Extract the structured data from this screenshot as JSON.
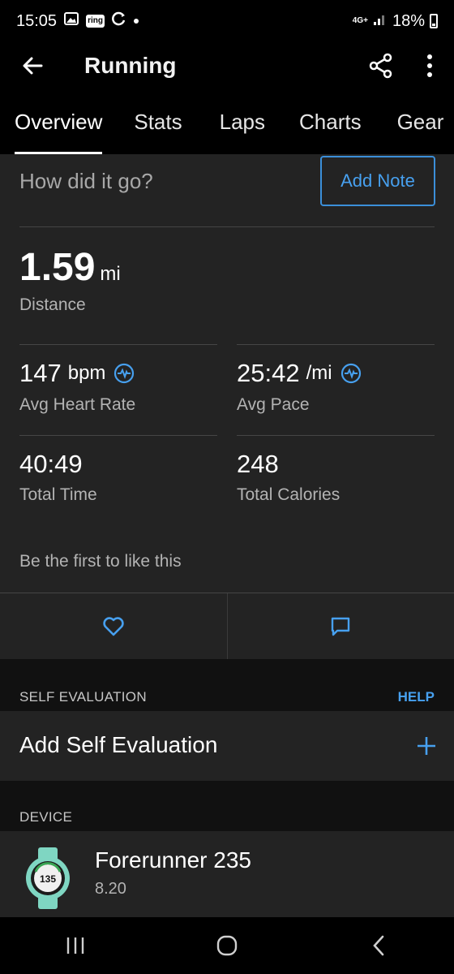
{
  "status_bar": {
    "time": "15:05",
    "network": "4G+",
    "battery": "18%",
    "icons": [
      "gallery-icon",
      "ring-icon",
      "sync-icon",
      "notification-dot-icon",
      "signal-icon",
      "battery-icon"
    ],
    "ring_label": "ring"
  },
  "app_bar": {
    "title": "Running",
    "back_icon": "arrow-left-icon",
    "share_icon": "share-icon",
    "more_icon": "more-vertical-icon"
  },
  "tabs": [
    {
      "label": "Overview",
      "active": true
    },
    {
      "label": "Stats",
      "active": false
    },
    {
      "label": "Laps",
      "active": false
    },
    {
      "label": "Charts",
      "active": false
    },
    {
      "label": "Gear",
      "active": false
    }
  ],
  "note": {
    "prompt": "How did it go?",
    "button_label": "Add Note"
  },
  "summary": {
    "distance_value": "1.59",
    "distance_unit": "mi",
    "distance_label": "Distance",
    "stats": [
      {
        "value": "147",
        "unit": "bpm",
        "label": "Avg Heart Rate",
        "icon": "heart-rate-zone-icon"
      },
      {
        "value": "25:42",
        "unit": "/mi",
        "label": "Avg Pace",
        "icon": "pace-zone-icon"
      },
      {
        "value": "40:49",
        "unit": "",
        "label": "Total Time"
      },
      {
        "value": "248",
        "unit": "",
        "label": "Total Calories"
      }
    ]
  },
  "social": {
    "likes_text": "Be the first to like this",
    "like_icon": "heart-icon",
    "comment_icon": "comment-icon"
  },
  "self_evaluation": {
    "section_title": "SELF EVALUATION",
    "help_label": "HELP",
    "row_label": "Add Self Evaluation",
    "add_icon": "plus-icon"
  },
  "device": {
    "section_title": "DEVICE",
    "name": "Forerunner 235",
    "version": "8.20",
    "watch_face_value": "135",
    "icon": "watch-icon"
  },
  "nav_bar": {
    "recents_icon": "recents-icon",
    "home_icon": "home-icon",
    "back_icon": "back-chevron-icon"
  },
  "colors": {
    "accent": "#47a0ef",
    "background": "#111111",
    "card": "#232323",
    "bar": "#000000",
    "watch_band": "#7fd6c2"
  }
}
